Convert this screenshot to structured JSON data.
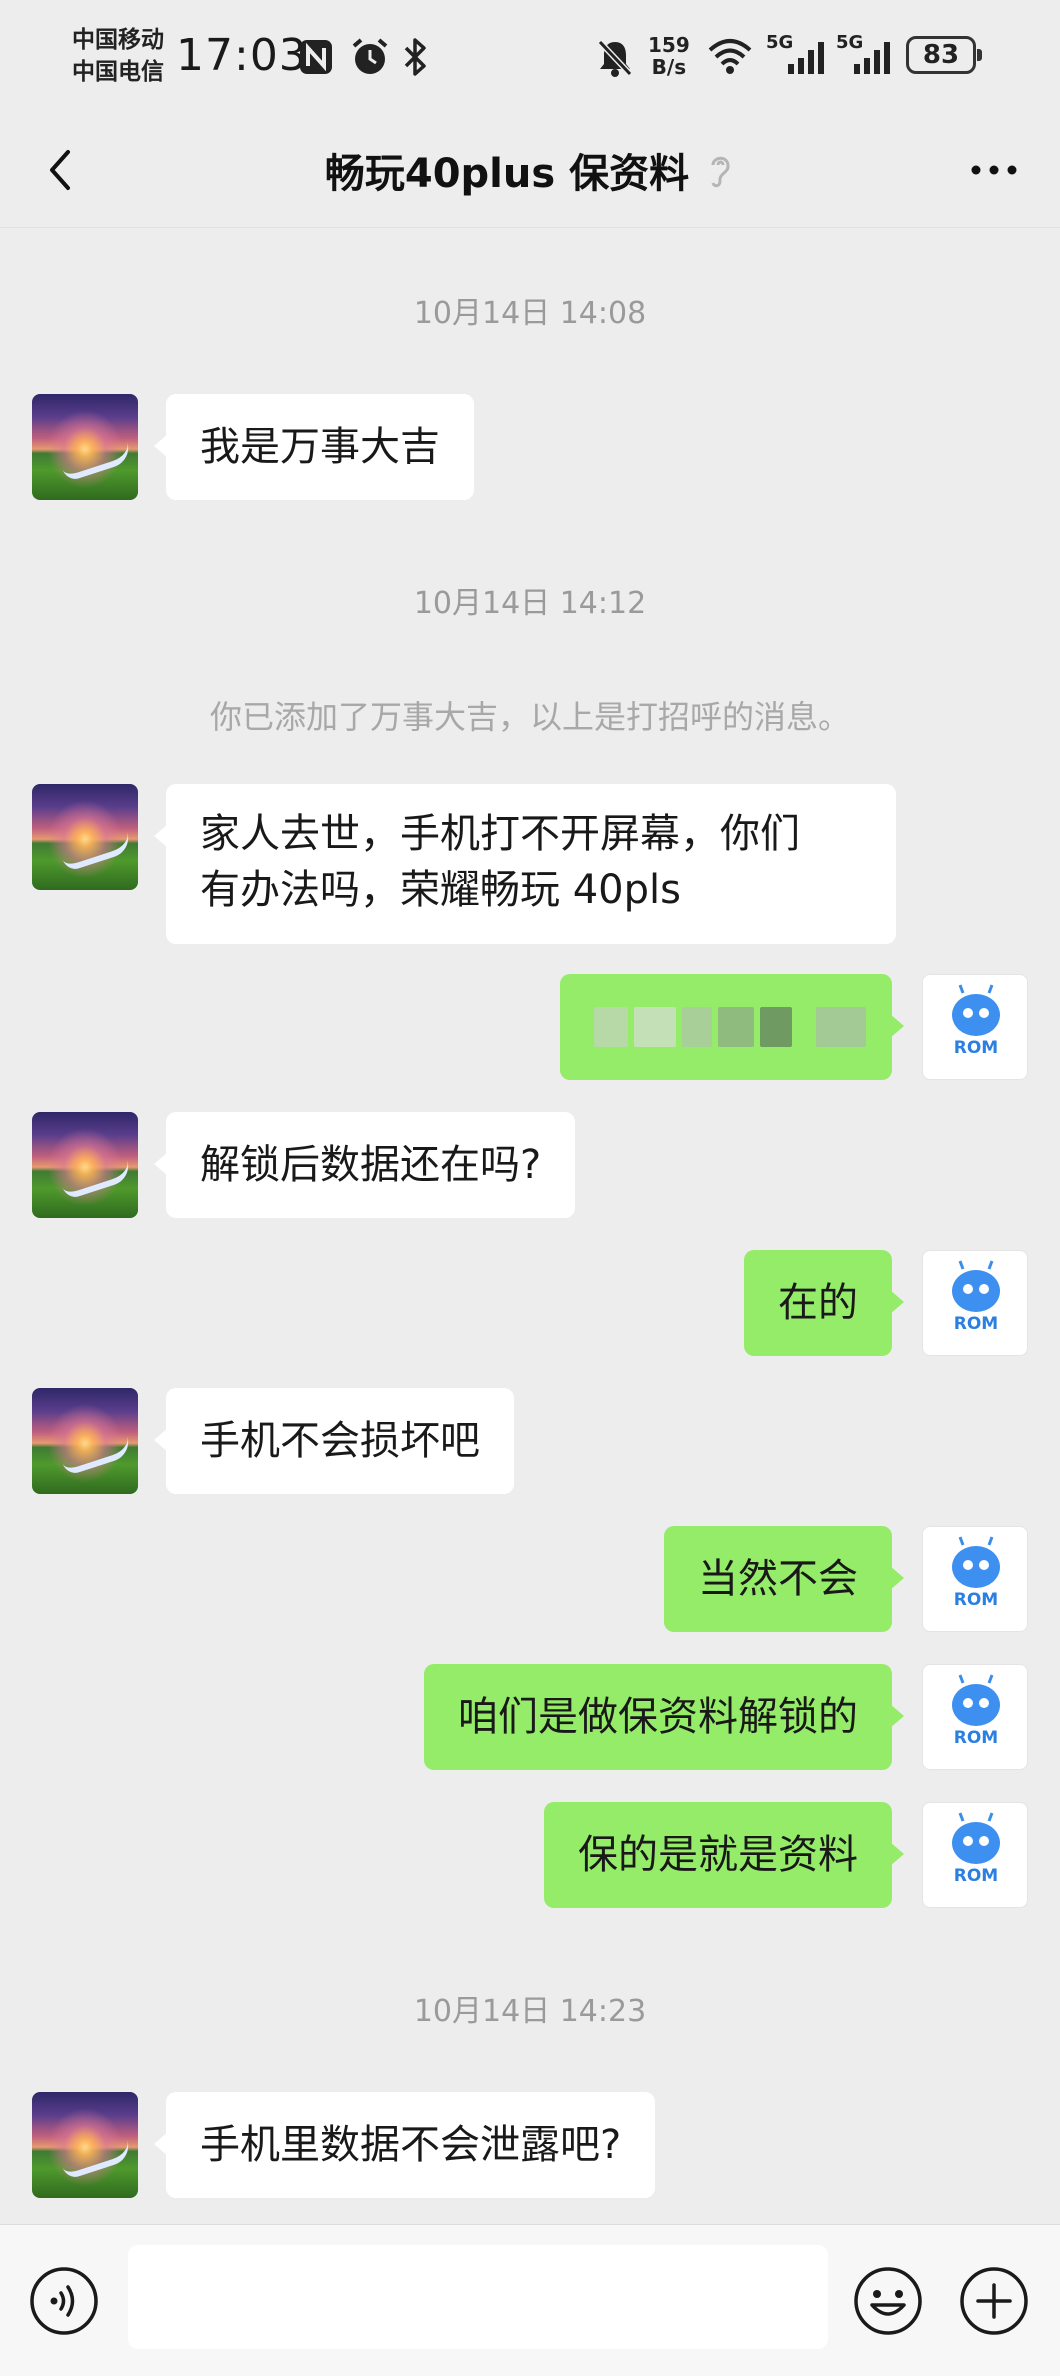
{
  "status_bar": {
    "carrier1": "中国移动",
    "carrier2": "中国电信",
    "time": "17:03",
    "net_speed_value": "159",
    "net_speed_unit": "B/s",
    "signal1": "5G",
    "signal2": "5G",
    "battery": "83"
  },
  "header": {
    "title": "畅玩40plus 保资料"
  },
  "chat": {
    "timestamps": [
      "10月14日 14:08",
      "10月14日 14:12",
      "10月14日 14:23"
    ],
    "system_message": "你已添加了万事大吉，以上是打招呼的消息。",
    "messages": [
      {
        "side": "left",
        "text": "我是万事大吉"
      },
      {
        "side": "left",
        "line1": "家人去世，手机打不开屏幕，你们",
        "line2": "有办法吗，荣耀畅玩 40pls"
      },
      {
        "side": "right",
        "text": ""
      },
      {
        "side": "left",
        "text": "解锁后数据还在吗?"
      },
      {
        "side": "right",
        "text": "在的"
      },
      {
        "side": "left",
        "text": "手机不会损坏吧"
      },
      {
        "side": "right",
        "text": "当然不会"
      },
      {
        "side": "right",
        "text": "咱们是做保资料解锁的"
      },
      {
        "side": "right",
        "text": "保的是就是资料"
      },
      {
        "side": "left",
        "text": "手机里数据不会泄露吧?"
      }
    ],
    "robot_avatar_label": "ROM"
  },
  "colors": {
    "background": "#ededed",
    "sent_bubble": "#95ec69",
    "received_bubble": "#ffffff"
  },
  "icons": [
    "nfc-icon",
    "alarm-icon",
    "bluetooth-icon",
    "mute-icon",
    "wifi-icon",
    "signal-icon",
    "back-icon",
    "earpiece-icon",
    "more-icon",
    "voice-icon",
    "emoji-icon",
    "plus-icon"
  ]
}
